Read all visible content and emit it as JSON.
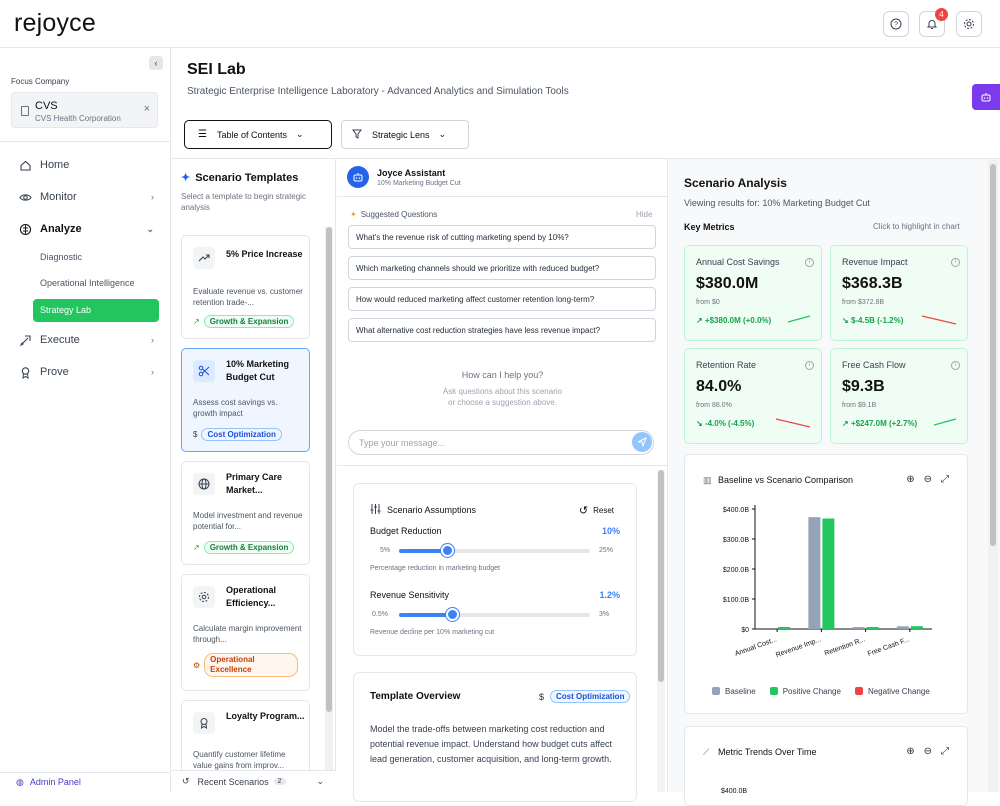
{
  "app": {
    "logo": "rejoyce",
    "notification_count": "4"
  },
  "sidebar": {
    "focus_label": "Focus Company",
    "company": {
      "name": "CVS",
      "full": "CVS Health Corporation"
    },
    "nav": [
      {
        "label": "Home"
      },
      {
        "label": "Monitor"
      },
      {
        "label": "Analyze"
      },
      {
        "label": "Execute"
      },
      {
        "label": "Prove"
      }
    ],
    "analyze_sub": [
      "Diagnostic",
      "Operational Intelligence",
      "Strategy Lab"
    ],
    "admin": "Admin Panel"
  },
  "header": {
    "title": "SEI Lab",
    "subtitle": "Strategic Enterprise Intelligence Laboratory - Advanced Analytics and Simulation Tools",
    "toc_label": "Table of Contents",
    "lens_label": "Strategic Lens"
  },
  "templates": {
    "title": "Scenario Templates",
    "desc": "Select a template to begin strategic analysis",
    "items": [
      {
        "name": "5% Price Increase",
        "desc": "Evaluate revenue vs. customer retention trade-...",
        "tag": "Growth & Expansion",
        "icon": "trending-up-icon"
      },
      {
        "name": "10% Marketing Budget Cut",
        "desc": "Assess cost savings vs. growth impact",
        "tag": "Cost Optimization",
        "icon": "scissors-icon"
      },
      {
        "name": "Primary Care Market...",
        "desc": "Model investment and revenue potential for...",
        "tag": "Growth & Expansion",
        "icon": "globe-icon"
      },
      {
        "name": "Operational Efficiency...",
        "desc": "Calculate margin improvement through...",
        "tag": "Operational Excellence",
        "icon": "gear-icon"
      },
      {
        "name": "Loyalty Program...",
        "desc": "Quantify customer lifetime value gains from improv...",
        "tag": "",
        "icon": "award-icon"
      }
    ],
    "recent_label": "Recent Scenarios",
    "recent_count": "2"
  },
  "assistant": {
    "name": "Joyce Assistant",
    "context": "10% Marketing Budget Cut",
    "suggested_label": "Suggested Questions",
    "hide_label": "Hide",
    "questions": [
      "What's the revenue risk of cutting marketing spend by 10%?",
      "Which marketing channels should we prioritize with reduced budget?",
      "How would reduced marketing affect customer retention long-term?",
      "What alternative cost reduction strategies have less revenue impact?"
    ],
    "help_title": "How can I help you?",
    "help_line1": "Ask questions about this scenario",
    "help_line2": "or choose a suggestion above.",
    "placeholder": "Type your message..."
  },
  "assumptions": {
    "title": "Scenario Assumptions",
    "reset": "Reset",
    "sliders": [
      {
        "label": "Budget Reduction",
        "value": "10%",
        "min": "5%",
        "max": "25%",
        "desc": "Percentage reduction in marketing budget",
        "fraction": 0.25
      },
      {
        "label": "Revenue Sensitivity",
        "value": "1.2%",
        "min": "0.5%",
        "max": "3%",
        "desc": "Revenue decline per 10% marketing cut",
        "fraction": 0.28
      }
    ]
  },
  "overview": {
    "title": "Template Overview",
    "tag": "Cost Optimization",
    "text": "Model the trade-offs between marketing cost reduction and potential revenue impact. Understand how budget cuts affect lead generation, customer acquisition, and long-term growth."
  },
  "analysis": {
    "title": "Scenario Analysis",
    "subtitle": "Viewing results for: 10% Marketing Budget Cut",
    "metrics_label": "Key Metrics",
    "metrics_hint": "Click to highlight in chart",
    "metrics": [
      {
        "label": "Annual Cost Savings",
        "value": "$380.0M",
        "from": "from $0",
        "change": "+$380.0M (+0.0%)",
        "trend": "up"
      },
      {
        "label": "Revenue Impact",
        "value": "$368.3B",
        "from": "from $372.8B",
        "change": "$-4.5B (-1.2%)",
        "trend": "down"
      },
      {
        "label": "Retention Rate",
        "value": "84.0%",
        "from": "from 88.0%",
        "change": "-4.0% (-4.5%)",
        "trend": "down"
      },
      {
        "label": "Free Cash Flow",
        "value": "$9.3B",
        "from": "from $9.1B",
        "change": "+$247.0M (+2.7%)",
        "trend": "up"
      }
    ],
    "chart1_title": "Baseline vs Scenario Comparison",
    "chart2_title": "Metric Trends Over Time",
    "chart2_first_tick": "$400.0B",
    "colors": {
      "baseline": "#94a3b8",
      "positive": "#22c55e",
      "negative": "#ef4444"
    }
  },
  "chart_data": {
    "type": "bar",
    "title": "Baseline vs Scenario Comparison",
    "categories": [
      "Annual Cost...",
      "Revenue Imp...",
      "Retention R...",
      "Free Cash F..."
    ],
    "series": [
      {
        "name": "Baseline",
        "values": [
          0,
          372.8,
          0.088,
          9.1
        ]
      },
      {
        "name": "Positive Change",
        "values": [
          0.38,
          368.3,
          0.084,
          9.3
        ]
      },
      {
        "name": "Negative Change",
        "values": [
          0,
          0,
          0,
          0
        ]
      }
    ],
    "yticks": [
      "$0",
      "$100.0B",
      "$200.0B",
      "$300.0B",
      "$400.0B"
    ],
    "ylim": [
      0,
      400
    ],
    "legend": "bottom"
  }
}
